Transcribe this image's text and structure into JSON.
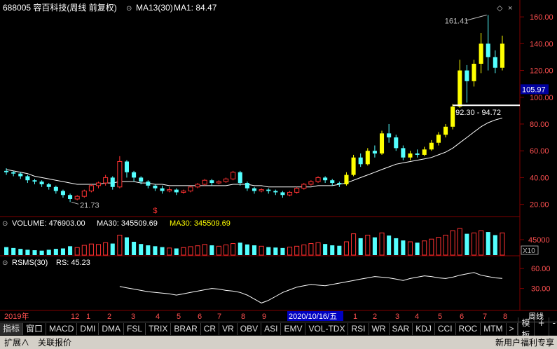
{
  "header": {
    "stock_title": "688005 容百科技(周线 前复权)",
    "ma_label": "MA13(30)",
    "ma_value": "MA1: 84.47"
  },
  "price_panel": {
    "y_ticks": [
      "160.00",
      "140.00",
      "120.00",
      "100.00",
      "80.00",
      "60.00",
      "40.00",
      "20.00"
    ],
    "current_price": "105.97",
    "high_label": "161.41",
    "low_label": "21.73",
    "range_label": "92.30 - 94.72",
    "marker": "$"
  },
  "volume_panel": {
    "label": "VOLUME: 476903.00",
    "ma_label": "MA30: 345509.69",
    "ma_label2": "MA30: 345509.69",
    "y_tick": "45000",
    "unit": "X10"
  },
  "rsms_panel": {
    "label": "RSMS(30)",
    "value": "RS: 45.23",
    "y_ticks": [
      "60.00",
      "30.00"
    ]
  },
  "time_axis": {
    "labels": [
      "2019年",
      "12",
      "1",
      "2",
      "3",
      "4",
      "5",
      "6",
      "7",
      "8",
      "9",
      "2020/10/16/五",
      "1",
      "2",
      "3",
      "4",
      "5",
      "6",
      "7",
      "8"
    ],
    "period": "周线"
  },
  "tabs": [
    "指标",
    "窗口",
    "MACD",
    "DMI",
    "DMA",
    "FSL",
    "TRIX",
    "BRAR",
    "CR",
    "VR",
    "OBV",
    "ASI",
    "EMV",
    "VOL-TDX",
    "RSI",
    "WR",
    "SAR",
    "KDJ",
    "CCI",
    "ROC",
    "MTM",
    ">"
  ],
  "right_buttons": [
    "模板",
    "+",
    "-"
  ],
  "status_bar": {
    "expand": "扩展∧",
    "quote": "关联报价",
    "right": "新用户福利专享"
  },
  "colors": {
    "up": "#ff3232",
    "down": "#54ffff",
    "highlight": "#ffff00",
    "ma": "#ffffff",
    "grid": "#800000"
  },
  "chart_data": {
    "type": "candlestick",
    "weeks": [
      {
        "o": 45,
        "c": 44,
        "h": 47,
        "l": 42
      },
      {
        "o": 44,
        "c": 43,
        "h": 45,
        "l": 41
      },
      {
        "o": 43,
        "c": 41,
        "h": 44,
        "l": 39
      },
      {
        "o": 41,
        "c": 38,
        "h": 42,
        "l": 36
      },
      {
        "o": 38,
        "c": 37,
        "h": 39,
        "l": 35
      },
      {
        "o": 37,
        "c": 35,
        "h": 38,
        "l": 33
      },
      {
        "o": 35,
        "c": 33,
        "h": 36,
        "l": 31
      },
      {
        "o": 33,
        "c": 30,
        "h": 34,
        "l": 28
      },
      {
        "o": 30,
        "c": 27,
        "h": 31,
        "l": 25
      },
      {
        "o": 27,
        "c": 24,
        "h": 28,
        "l": 21.73
      },
      {
        "o": 24,
        "c": 26,
        "h": 27,
        "l": 23
      },
      {
        "o": 26,
        "c": 30,
        "h": 31,
        "l": 25
      },
      {
        "o": 30,
        "c": 34,
        "h": 35,
        "l": 29
      },
      {
        "o": 34,
        "c": 36,
        "h": 37,
        "l": 32
      },
      {
        "o": 36,
        "c": 40,
        "h": 42,
        "l": 34
      },
      {
        "o": 40,
        "c": 33,
        "h": 41,
        "l": 31
      },
      {
        "o": 33,
        "c": 52,
        "h": 56,
        "l": 32
      },
      {
        "o": 52,
        "c": 44,
        "h": 53,
        "l": 40
      },
      {
        "o": 44,
        "c": 40,
        "h": 45,
        "l": 37
      },
      {
        "o": 40,
        "c": 37,
        "h": 41,
        "l": 35
      },
      {
        "o": 37,
        "c": 34,
        "h": 38,
        "l": 32
      },
      {
        "o": 34,
        "c": 32,
        "h": 35,
        "l": 30
      },
      {
        "o": 32,
        "c": 30,
        "h": 34,
        "l": 28
      },
      {
        "o": 30,
        "c": 31,
        "h": 33,
        "l": 29
      },
      {
        "o": 31,
        "c": 29,
        "h": 32,
        "l": 27
      },
      {
        "o": 29,
        "c": 30,
        "h": 31,
        "l": 28
      },
      {
        "o": 30,
        "c": 33,
        "h": 34,
        "l": 29
      },
      {
        "o": 33,
        "c": 35,
        "h": 36,
        "l": 32
      },
      {
        "o": 35,
        "c": 38,
        "h": 39,
        "l": 34
      },
      {
        "o": 38,
        "c": 36,
        "h": 39,
        "l": 34
      },
      {
        "o": 36,
        "c": 37,
        "h": 38,
        "l": 35
      },
      {
        "o": 37,
        "c": 39,
        "h": 40,
        "l": 36
      },
      {
        "o": 39,
        "c": 44,
        "h": 45,
        "l": 38
      },
      {
        "o": 44,
        "c": 36,
        "h": 45,
        "l": 34
      },
      {
        "o": 36,
        "c": 32,
        "h": 37,
        "l": 30
      },
      {
        "o": 32,
        "c": 30,
        "h": 33,
        "l": 28
      },
      {
        "o": 30,
        "c": 31,
        "h": 32,
        "l": 29
      },
      {
        "o": 31,
        "c": 30,
        "h": 32,
        "l": 28
      },
      {
        "o": 30,
        "c": 29,
        "h": 31,
        "l": 27
      },
      {
        "o": 29,
        "c": 27,
        "h": 30,
        "l": 25
      },
      {
        "o": 27,
        "c": 29,
        "h": 30,
        "l": 26
      },
      {
        "o": 29,
        "c": 32,
        "h": 33,
        "l": 28
      },
      {
        "o": 32,
        "c": 35,
        "h": 36,
        "l": 31
      },
      {
        "o": 35,
        "c": 37,
        "h": 38,
        "l": 34
      },
      {
        "o": 37,
        "c": 40,
        "h": 41,
        "l": 36
      },
      {
        "o": 40,
        "c": 38,
        "h": 41,
        "l": 36
      },
      {
        "o": 38,
        "c": 36,
        "h": 39,
        "l": 34
      },
      {
        "o": 36,
        "c": 35,
        "h": 37,
        "l": 33
      },
      {
        "o": 35,
        "c": 42,
        "h": 44,
        "l": 34
      },
      {
        "o": 42,
        "c": 55,
        "h": 57,
        "l": 41
      },
      {
        "o": 55,
        "c": 50,
        "h": 58,
        "l": 48
      },
      {
        "o": 50,
        "c": 60,
        "h": 62,
        "l": 49
      },
      {
        "o": 60,
        "c": 58,
        "h": 64,
        "l": 55
      },
      {
        "o": 58,
        "c": 73,
        "h": 75,
        "l": 57
      },
      {
        "o": 73,
        "c": 70,
        "h": 80,
        "l": 66
      },
      {
        "o": 70,
        "c": 62,
        "h": 72,
        "l": 60
      },
      {
        "o": 62,
        "c": 55,
        "h": 64,
        "l": 53
      },
      {
        "o": 55,
        "c": 58,
        "h": 60,
        "l": 53
      },
      {
        "o": 58,
        "c": 57,
        "h": 61,
        "l": 55
      },
      {
        "o": 57,
        "c": 61,
        "h": 63,
        "l": 56
      },
      {
        "o": 61,
        "c": 66,
        "h": 68,
        "l": 60
      },
      {
        "o": 66,
        "c": 72,
        "h": 74,
        "l": 64
      },
      {
        "o": 72,
        "c": 78,
        "h": 80,
        "l": 70
      },
      {
        "o": 78,
        "c": 93,
        "h": 95,
        "l": 76
      },
      {
        "o": 93,
        "c": 120,
        "h": 128,
        "l": 92
      },
      {
        "o": 120,
        "c": 112,
        "h": 124,
        "l": 96
      },
      {
        "o": 112,
        "c": 125,
        "h": 128,
        "l": 108
      },
      {
        "o": 125,
        "c": 140,
        "h": 148,
        "l": 118
      },
      {
        "o": 140,
        "c": 130,
        "h": 161.41,
        "l": 120
      },
      {
        "o": 130,
        "c": 122,
        "h": 135,
        "l": 118
      },
      {
        "o": 122,
        "c": 140,
        "h": 146,
        "l": 120
      }
    ],
    "volumes": [
      18,
      16,
      14,
      12,
      11,
      10,
      12,
      14,
      15,
      20,
      17,
      22,
      25,
      24,
      28,
      26,
      45,
      40,
      30,
      25,
      22,
      20,
      18,
      16,
      15,
      17,
      19,
      21,
      24,
      22,
      20,
      23,
      26,
      28,
      24,
      22,
      20,
      18,
      17,
      16,
      18,
      20,
      23,
      26,
      28,
      25,
      22,
      21,
      30,
      48,
      38,
      45,
      40,
      50,
      44,
      38,
      33,
      30,
      28,
      32,
      36,
      40,
      45,
      55,
      60,
      48,
      50,
      55,
      52,
      45,
      50
    ],
    "ma_line": [
      46,
      45,
      44,
      43,
      41,
      40,
      39,
      38,
      37,
      36,
      35,
      35,
      35,
      35,
      36,
      36,
      37,
      37,
      37,
      36,
      36,
      35,
      35,
      34,
      34,
      34,
      34,
      34,
      34,
      34,
      34,
      34,
      35,
      35,
      35,
      34,
      34,
      33,
      33,
      33,
      33,
      33,
      33,
      33,
      34,
      34,
      34,
      35,
      36,
      38,
      40,
      42,
      44,
      46,
      48,
      50,
      51,
      52,
      53,
      54,
      55,
      57,
      59,
      62,
      66,
      70,
      74,
      78,
      81,
      83,
      84.47
    ],
    "rsms_line": [
      20,
      19,
      18,
      17,
      15,
      13,
      12,
      14,
      16,
      18,
      20,
      22,
      24,
      26,
      28,
      30,
      33,
      31,
      29,
      27,
      25,
      24,
      23,
      22,
      20,
      22,
      24,
      26,
      28,
      30,
      29,
      27,
      26,
      24,
      20,
      14,
      8,
      12,
      18,
      24,
      28,
      32,
      34,
      36,
      35,
      34,
      36,
      38,
      40,
      42,
      44,
      46,
      48,
      47,
      46,
      44,
      42,
      45,
      47,
      49,
      48,
      46,
      45,
      47,
      50,
      52,
      54,
      50,
      48,
      46,
      45.23
    ],
    "ylim_price": [
      13,
      170
    ],
    "ylim_rsms": [
      0,
      75
    ]
  }
}
